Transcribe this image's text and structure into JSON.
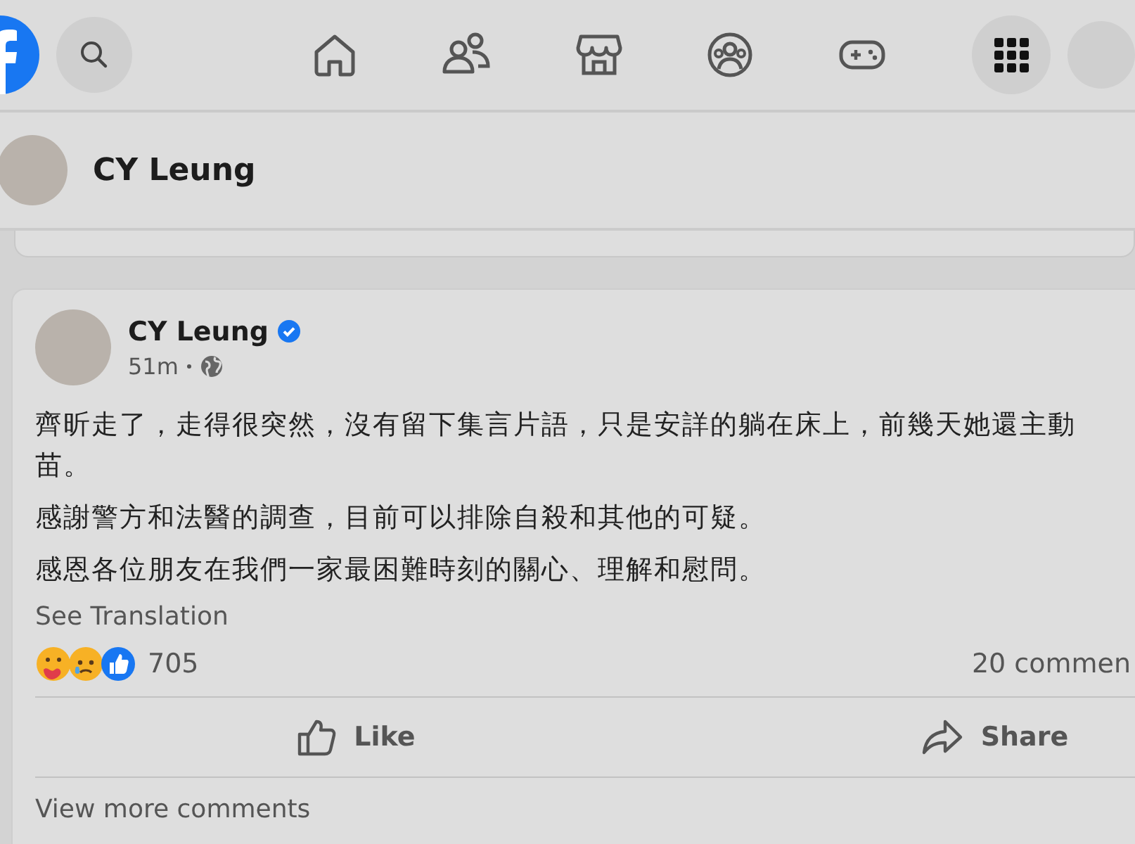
{
  "profile_header": {
    "name": "CY Leung"
  },
  "post": {
    "author": "CY Leung",
    "verified": true,
    "time": "51m",
    "paragraphs": [
      "齊昕走了，走得很突然，沒有留下集言片語，只是安詳的躺在床上，前幾天她還主動苗。",
      "感謝警方和法醫的調查，目前可以排除自殺和其他的可疑。",
      "感恩各位朋友在我們一家最困難時刻的關心、理解和慰問。"
    ],
    "see_translation": "See Translation",
    "reaction_count": "705",
    "comment_count": "20 commen",
    "actions": [
      {
        "kind": "like",
        "label": "Like"
      },
      {
        "kind": "share",
        "label": "Share"
      }
    ],
    "view_more": "View more comments"
  }
}
